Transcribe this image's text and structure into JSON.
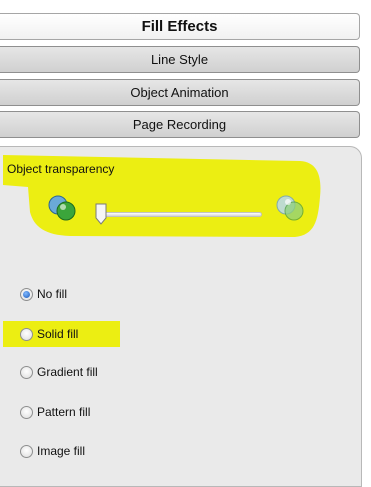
{
  "tabs": [
    {
      "label": "Fill Effects",
      "active": true
    },
    {
      "label": "Line Style",
      "active": false
    },
    {
      "label": "Object Animation",
      "active": false
    },
    {
      "label": "Page Recording",
      "active": false
    }
  ],
  "transparency": {
    "label": "Object transparency",
    "value": 0.0,
    "left_icon": "opaque-orbs-icon",
    "right_icon": "transparent-orbs-icon"
  },
  "fill_options": [
    {
      "label": "No fill",
      "checked": true
    },
    {
      "label": "Solid fill",
      "checked": false
    },
    {
      "label": "Gradient fill",
      "checked": false
    },
    {
      "label": "Pattern fill",
      "checked": false
    },
    {
      "label": "Image fill",
      "checked": false
    }
  ],
  "colors": {
    "highlight": "#ecee12",
    "panel_bg": "#eaeaea",
    "radio_selected": "#1b58b8"
  }
}
